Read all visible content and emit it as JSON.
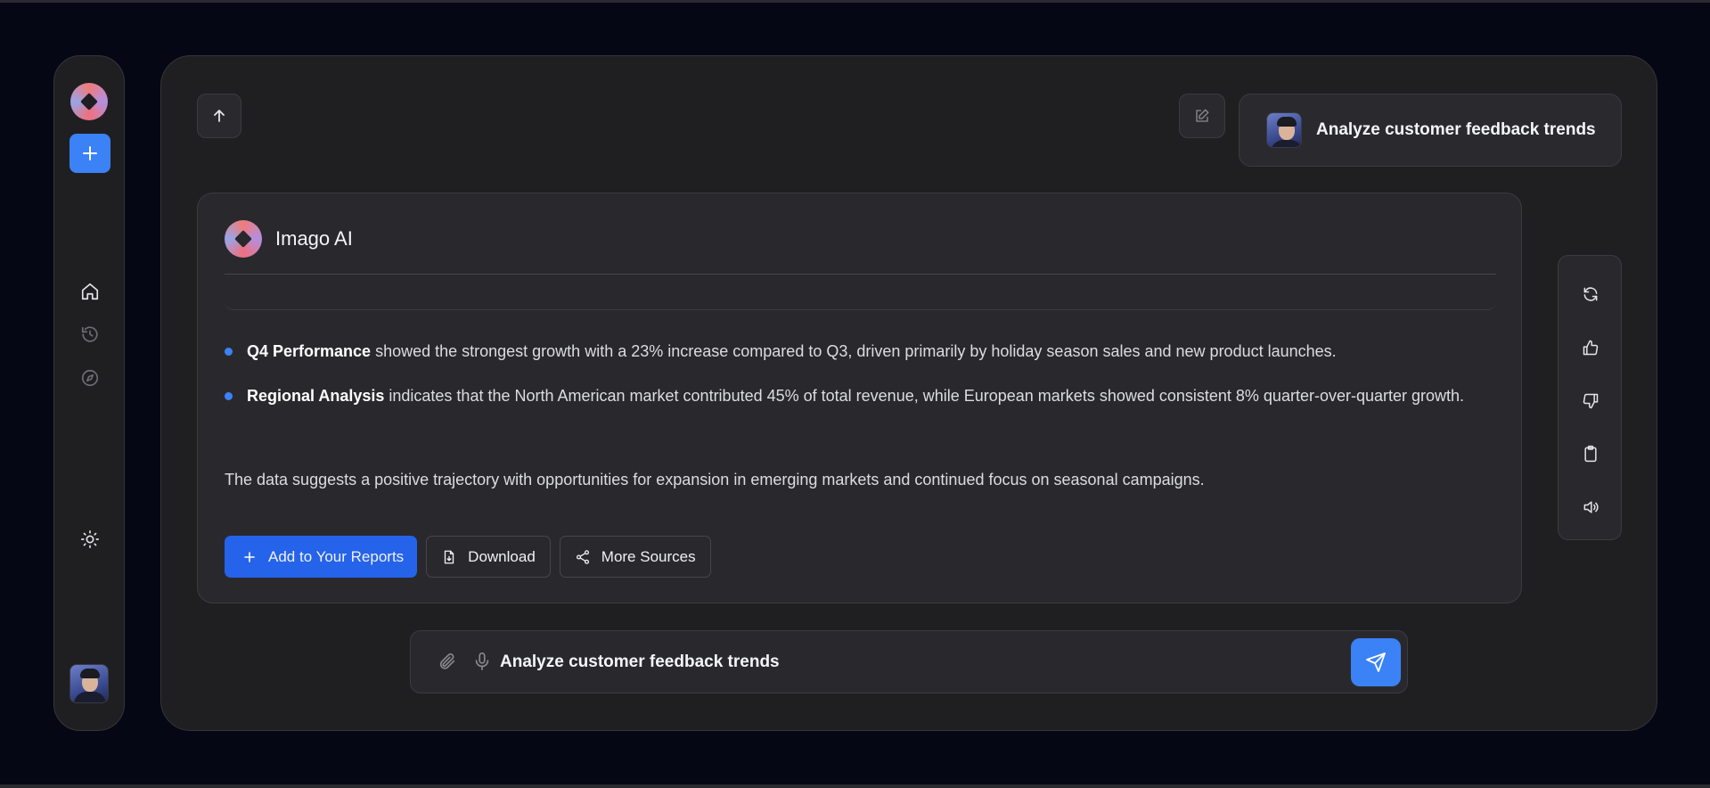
{
  "app": {
    "name": "Imago AI"
  },
  "sidebar": {
    "items": [
      {
        "name": "home",
        "icon": "home-icon"
      },
      {
        "name": "history",
        "icon": "history-icon"
      },
      {
        "name": "explore",
        "icon": "compass-icon"
      },
      {
        "name": "theme",
        "icon": "sun-icon"
      }
    ]
  },
  "chat": {
    "user_message": "Analyze customer feedback trends",
    "assistant_name": "Imago AI",
    "bullets": [
      {
        "bold": "Q4 Performance",
        "text": " showed the strongest growth with a 23% increase compared to Q3, driven primarily by holiday season sales and new product launches."
      },
      {
        "bold": "Regional Analysis",
        "text": " indicates that the North American market contributed 45% of total revenue, while European markets showed consistent 8% quarter-over-quarter growth."
      }
    ],
    "summary": "The data suggests a positive trajectory with opportunities for expansion in emerging markets and continued focus on seasonal campaigns.",
    "actions": {
      "add_reports": "Add to Your Reports",
      "download": "Download",
      "more_sources": "More Sources"
    }
  },
  "composer": {
    "value": "Analyze customer feedback trends"
  },
  "colors": {
    "accent": "#3b82f6",
    "primary_button": "#2563eb",
    "background": "#050814",
    "panel": "#1f1f22",
    "card": "#29292d"
  }
}
